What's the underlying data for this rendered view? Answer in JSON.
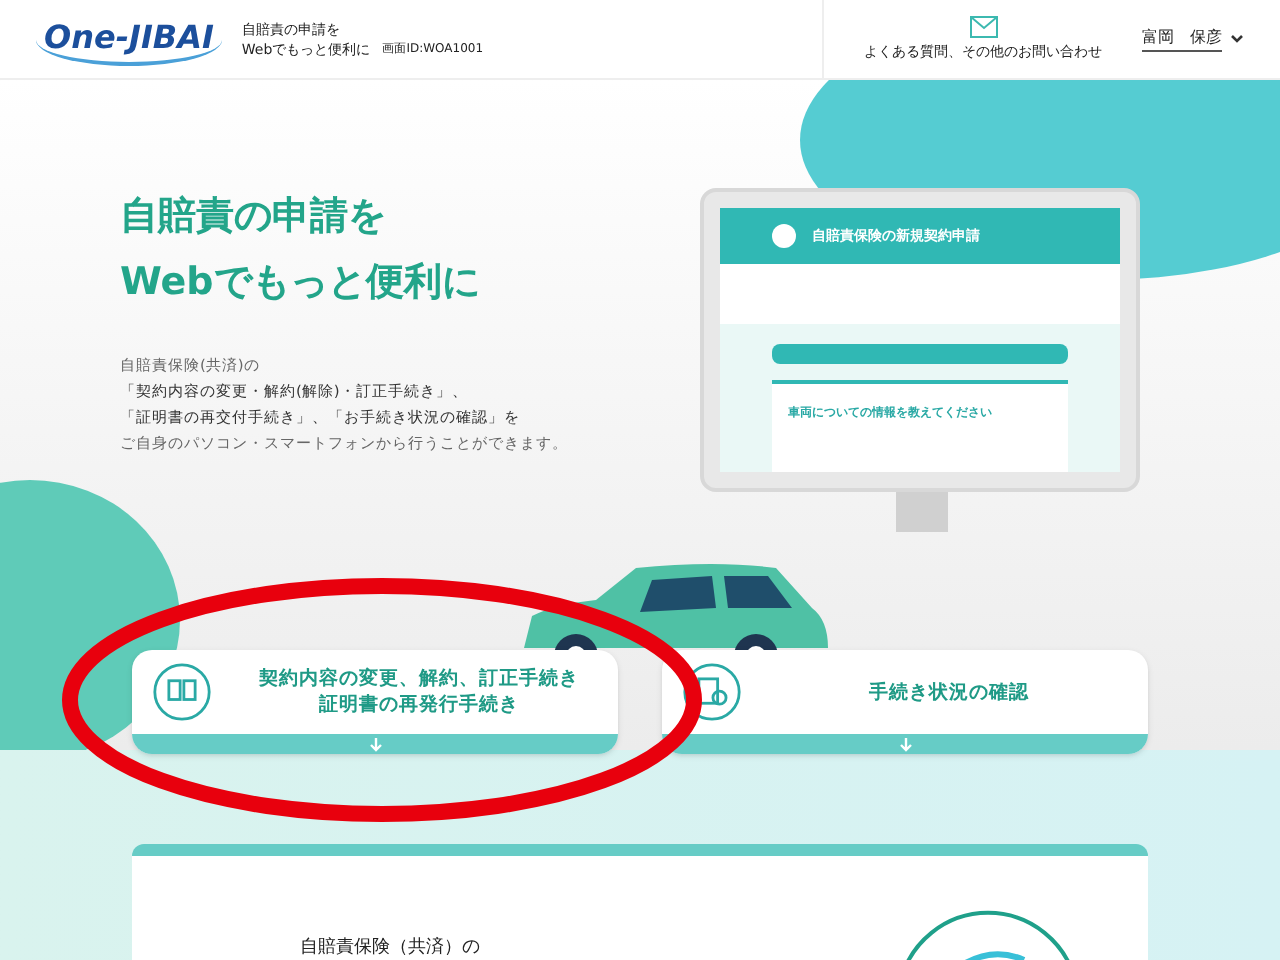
{
  "header": {
    "logo": "One-JIBAI",
    "tagline": "自賠責の申請を\nWebでもっと便利に",
    "screen_id": "画面ID:WOA1001",
    "help_link": "よくある質問、その他のお問い合わせ",
    "user_name": "富岡　保彦"
  },
  "hero": {
    "title_lines": [
      "自賠責の申請を",
      "Webでもっと便利に"
    ],
    "description_lines": [
      {
        "text": "自賠責保険(共済)の",
        "bold": false
      },
      {
        "text": "「契約内容の変更・解約(解除)・訂正手続き」、",
        "bold": true
      },
      {
        "text": "「証明書の再交付手続き」、「お手続き状況の確認」を",
        "bold": true
      },
      {
        "text": "ご自身のパソコン・スマートフォンから行うことができます。",
        "bold": false
      }
    ],
    "mockup": {
      "title": "自賠責保険の新規契約申請",
      "question": "車両についての情報を教えてください"
    }
  },
  "action_cards": [
    {
      "lines": [
        "契約内容の変更、解約、訂正手続き",
        "証明書の再発行手続き"
      ],
      "kind": "documents"
    },
    {
      "lines": [
        "手続き状況の確認"
      ],
      "kind": "search"
    }
  ],
  "info_card": {
    "text": "自賠責保険（共済）の"
  }
}
